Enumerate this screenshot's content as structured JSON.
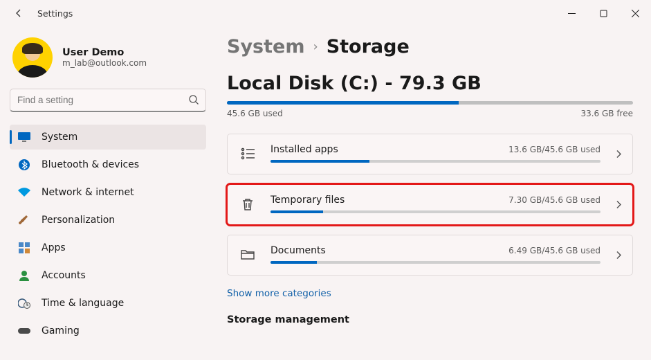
{
  "window": {
    "title": "Settings"
  },
  "profile": {
    "name": "User Demo",
    "email": "m_lab@outlook.com"
  },
  "search": {
    "placeholder": "Find a setting"
  },
  "sidebar": {
    "items": [
      {
        "label": "System",
        "icon": "monitor-icon",
        "active": true
      },
      {
        "label": "Bluetooth & devices",
        "icon": "bluetooth-icon"
      },
      {
        "label": "Network & internet",
        "icon": "wifi-icon"
      },
      {
        "label": "Personalization",
        "icon": "brush-icon"
      },
      {
        "label": "Apps",
        "icon": "apps-icon"
      },
      {
        "label": "Accounts",
        "icon": "person-icon"
      },
      {
        "label": "Time & language",
        "icon": "clock-globe-icon"
      },
      {
        "label": "Gaming",
        "icon": "gamepad-icon"
      }
    ]
  },
  "breadcrumb": {
    "parent": "System",
    "current": "Storage"
  },
  "disk": {
    "title": "Local Disk (C:) - 79.3 GB",
    "used_label": "45.6 GB used",
    "free_label": "33.6 GB free",
    "fill_percent": 57
  },
  "categories": [
    {
      "title": "Installed apps",
      "usage": "13.6 GB/45.6 GB used",
      "fill_percent": 30,
      "icon": "list-icon",
      "highlight": false
    },
    {
      "title": "Temporary files",
      "usage": "7.30 GB/45.6 GB used",
      "fill_percent": 16,
      "icon": "trash-icon",
      "highlight": true
    },
    {
      "title": "Documents",
      "usage": "6.49 GB/45.6 GB used",
      "fill_percent": 14,
      "icon": "folder-icon",
      "highlight": false
    }
  ],
  "more_link": "Show more categories",
  "section": {
    "storage_management": "Storage management"
  }
}
